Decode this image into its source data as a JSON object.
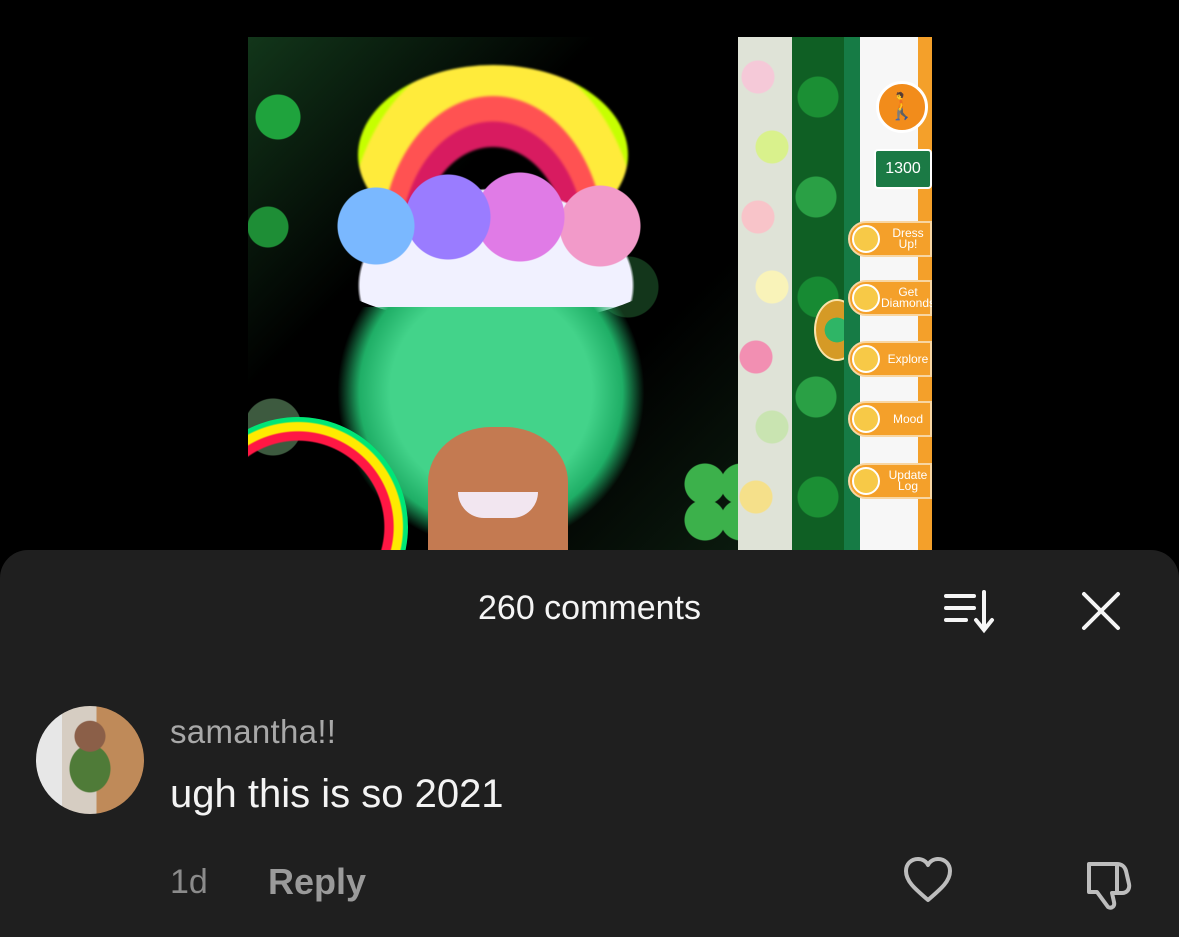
{
  "video": {
    "game_panel": {
      "score": "1300",
      "buttons": [
        {
          "label": "Dress Up!",
          "icon": "dress-icon"
        },
        {
          "label": "Get Diamonds",
          "icon": "diamond-icon"
        },
        {
          "label": "Explore",
          "icon": "compass-icon"
        },
        {
          "label": "Mood",
          "icon": "smiley-icon"
        },
        {
          "label": "Update Log",
          "icon": "clipboard-icon"
        }
      ]
    }
  },
  "comments_sheet": {
    "title": "260 comments",
    "sort_icon": "sort-icon",
    "close_icon": "close-icon"
  },
  "comment": {
    "username": "samantha!!",
    "text": "ugh this is so 2021",
    "time": "1d",
    "reply_label": "Reply",
    "like_icon": "heart-outline-icon",
    "dislike_icon": "thumbs-down-outline-icon"
  },
  "colors": {
    "sheet_background": "#1f1f1f",
    "title_text": "#f5f5f5",
    "secondary_text": "#a8a8a8"
  }
}
